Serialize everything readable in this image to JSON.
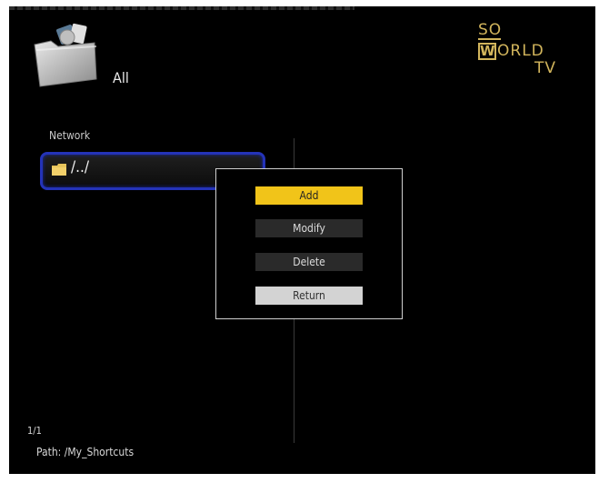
{
  "category": {
    "label": "All"
  },
  "logo": {
    "line1": "SO",
    "w_letter": "W",
    "line2_rest": "ORLD",
    "line3": "TV",
    "color": "#d2b55c"
  },
  "section": {
    "label": "Network"
  },
  "list": {
    "items": [
      {
        "label": "/../",
        "icon": "folder-icon"
      }
    ]
  },
  "menu": {
    "items": [
      {
        "label": "Add",
        "state": "selected",
        "color": "#f1c419"
      },
      {
        "label": "Modify"
      },
      {
        "label": "Delete"
      },
      {
        "label": "Return"
      }
    ]
  },
  "footer": {
    "page": "1/1",
    "path": "Path: /My_Shortcuts"
  },
  "colors": {
    "background": "#000000",
    "focus_border": "#2433b8"
  }
}
